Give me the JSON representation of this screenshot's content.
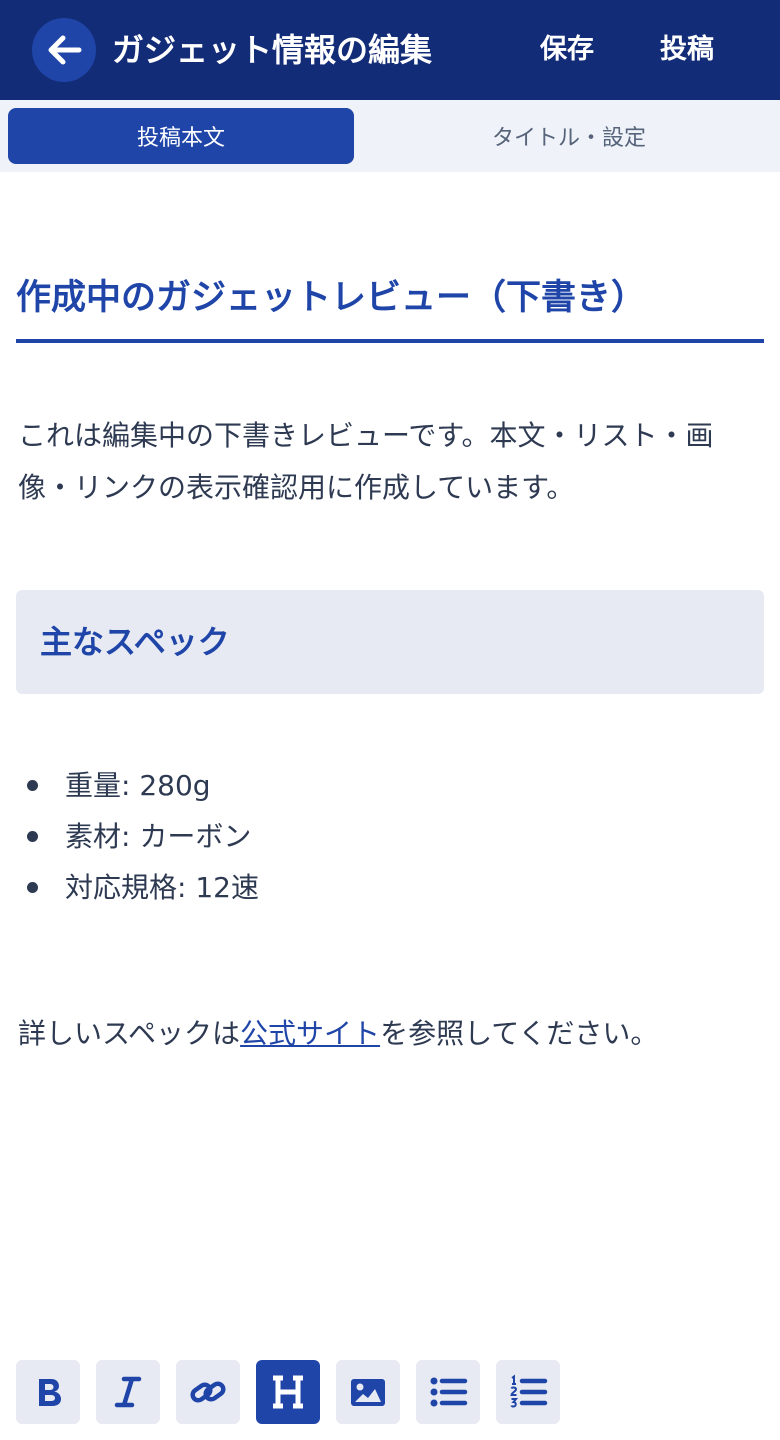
{
  "header": {
    "title": "ガジェット情報の編集",
    "save_label": "保存",
    "post_label": "投稿",
    "back_icon": "arrow-left-icon"
  },
  "tabs": [
    {
      "label": "投稿本文",
      "active": true
    },
    {
      "label": "タイトル・設定",
      "active": false
    }
  ],
  "document": {
    "title": "作成中のガジェットレビュー（下書き）",
    "intro": "これは編集中の下書きレビューです。本文・リスト・画像・リンクの表示確認用に作成しています。",
    "spec_heading": "主なスペック",
    "spec_items": [
      "重量: 280g",
      "素材: カーボン",
      "対応規格: 12速"
    ],
    "link_paragraph": {
      "before": "詳しいスペックは",
      "link_text": "公式サイト",
      "after": "を参照してください。"
    }
  },
  "toolbar": {
    "buttons": [
      {
        "icon": "bold-icon",
        "active": false
      },
      {
        "icon": "italic-icon",
        "active": false
      },
      {
        "icon": "link-icon",
        "active": false
      },
      {
        "icon": "heading-icon",
        "active": true
      },
      {
        "icon": "image-icon",
        "active": false
      },
      {
        "icon": "bullet-list-icon",
        "active": false
      },
      {
        "icon": "numbered-list-icon",
        "active": false
      }
    ]
  },
  "colors": {
    "header_bg": "#132c78",
    "accent": "#1f45a8",
    "tab_bar_bg": "#eff3f9",
    "panel_bg": "#e7eaf3",
    "body_text": "#2e3a52"
  }
}
